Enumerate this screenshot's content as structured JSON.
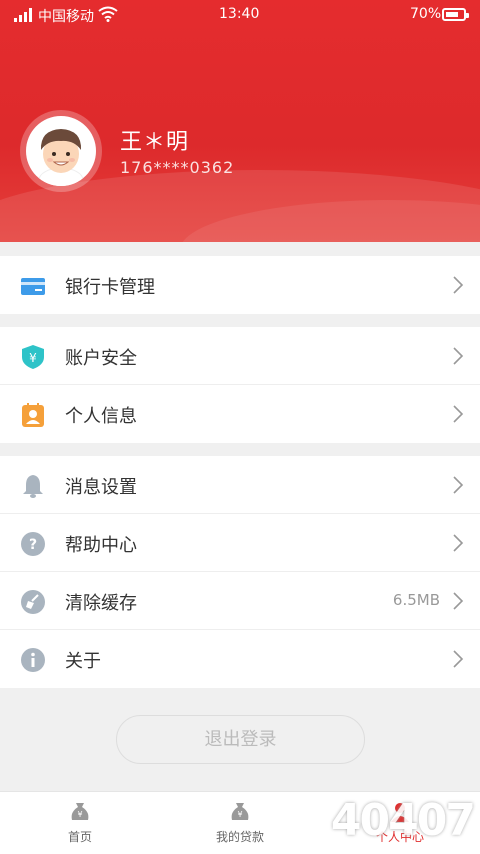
{
  "status_bar": {
    "carrier": "中国移动",
    "time": "13:40",
    "battery": "70%"
  },
  "profile": {
    "name": "王＊明",
    "phone": "176****0362"
  },
  "menu": {
    "bank_card": {
      "label": "银行卡管理"
    },
    "account_security": {
      "label": "账户安全"
    },
    "personal_info": {
      "label": "个人信息"
    },
    "notification_settings": {
      "label": "消息设置"
    },
    "help_center": {
      "label": "帮助中心"
    },
    "clear_cache": {
      "label": "清除缓存",
      "value": "6.5MB"
    },
    "about": {
      "label": "关于"
    }
  },
  "logout_label": "退出登录",
  "tabs": [
    {
      "label": "首页"
    },
    {
      "label": "我的贷款"
    },
    {
      "label": "个人中心"
    }
  ],
  "watermark": "40407",
  "colors": {
    "brand": "#dd2a2c",
    "card_icon": "#3d9be9",
    "shield_icon": "#2ec3c8",
    "person_icon": "#f5a03a",
    "gray_icon": "#a9b4bf"
  }
}
